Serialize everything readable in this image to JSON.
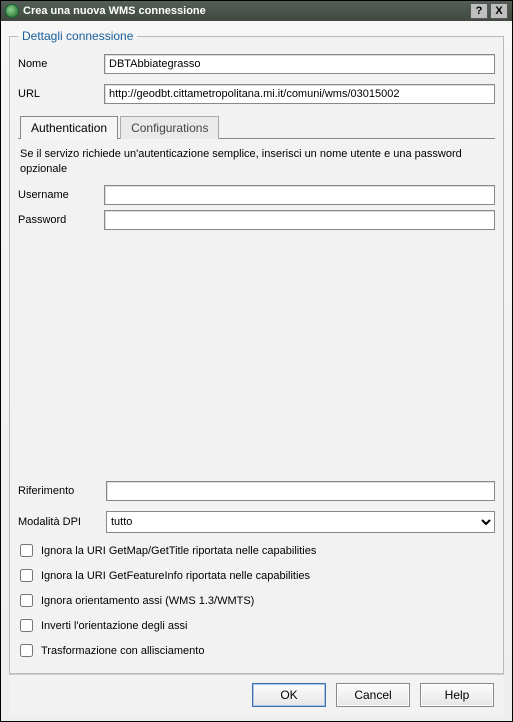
{
  "titlebar": {
    "text": "Crea una nuova WMS connessione"
  },
  "group": {
    "legend": "Dettagli connessione"
  },
  "fields": {
    "name_label": "Nome",
    "name_value": "DBTAbbiategrasso",
    "url_label": "URL",
    "url_value": "http://geodbt.cittametropolitana.mi.it/comuni/wms/03015002"
  },
  "tabs": {
    "auth": "Authentication",
    "conf": "Configurations"
  },
  "auth": {
    "hint": "Se il servizo richiede un'autenticazione semplice, inserisci un nome utente e una password opzionale",
    "user_label": "Username",
    "user_value": "",
    "pass_label": "Password",
    "pass_value": ""
  },
  "lower": {
    "refer_label": "Riferimento",
    "refer_value": "",
    "dpi_label": "Modalità DPI",
    "dpi_selected": "tutto"
  },
  "checks": {
    "c1": "Ignora la URI GetMap/GetTitle riportata nelle capabilities",
    "c2": "Ignora la URI GetFeatureInfo riportata nelle capabilities",
    "c3": "Ignora orientamento assi (WMS 1.3/WMTS)",
    "c4": "Inverti l'orientazione degli assi",
    "c5": "Trasformazione con allisciamento"
  },
  "buttons": {
    "ok": "OK",
    "cancel": "Cancel",
    "help": "Help"
  },
  "win": {
    "help": "?",
    "close": "X"
  }
}
